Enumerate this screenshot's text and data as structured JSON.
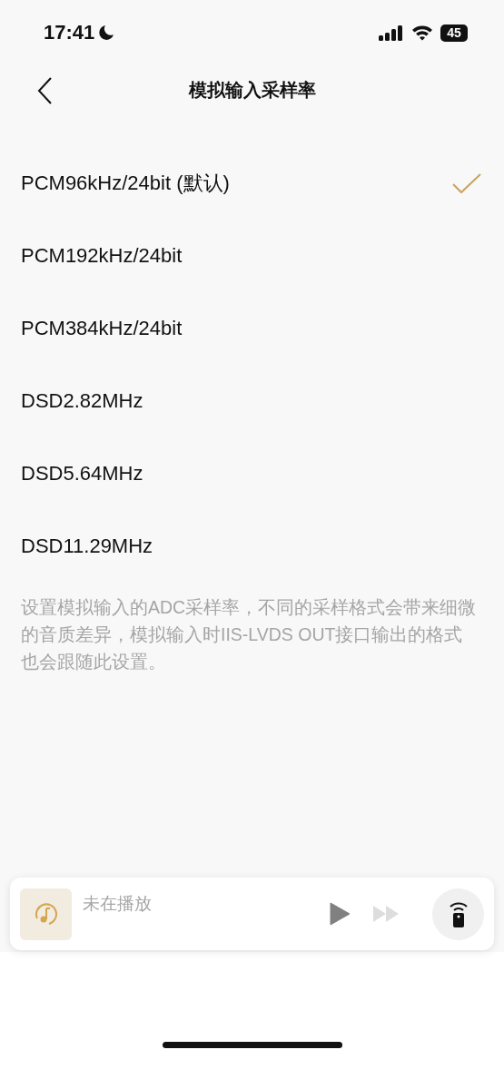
{
  "status_bar": {
    "time": "17:41",
    "battery": "45"
  },
  "nav": {
    "title": "模拟输入采样率"
  },
  "options": [
    {
      "label": "PCM96kHz/24bit (默认)",
      "selected": true
    },
    {
      "label": "PCM192kHz/24bit",
      "selected": false
    },
    {
      "label": "PCM384kHz/24bit",
      "selected": false
    },
    {
      "label": "DSD2.82MHz",
      "selected": false
    },
    {
      "label": "DSD5.64MHz",
      "selected": false
    },
    {
      "label": "DSD11.29MHz",
      "selected": false
    }
  ],
  "description": "设置模拟输入的ADC采样率，不同的采样格式会带来细微的音质差异，模拟输入时IIS-LVDS OUT接口输出的格式也会跟随此设置。",
  "player": {
    "status": "未在播放",
    "next_disabled": true
  }
}
